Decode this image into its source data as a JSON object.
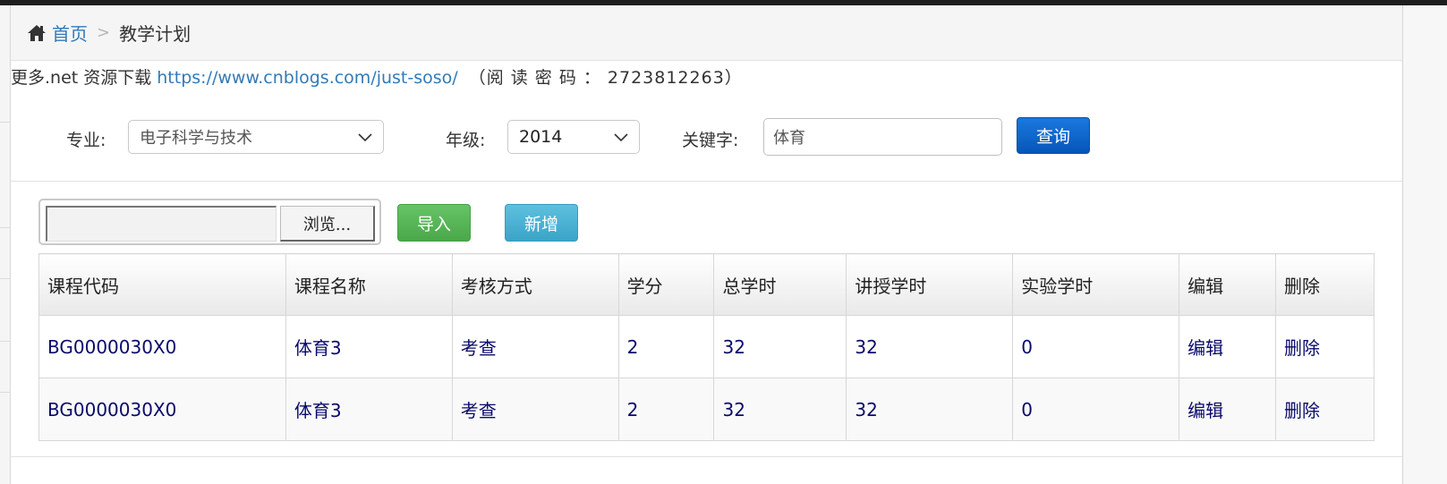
{
  "breadcrumb": {
    "icon": "home-icon",
    "home": "首页",
    "separator": ">",
    "current": "教学计划"
  },
  "notice": {
    "prefix": "更多.net 资源下载",
    "link": "https://www.cnblogs.com/just-soso/",
    "password": "（阅 读 密 码 ： 2723812263）"
  },
  "filters": {
    "major_label": "专业:",
    "major_value": "电子科学与技术",
    "grade_label": "年级:",
    "grade_value": "2014",
    "keyword_label": "关键字:",
    "keyword_value": "体育",
    "query_button": "查询"
  },
  "actions": {
    "browse_button": "浏览...",
    "import_button": "导入",
    "add_button": "新增"
  },
  "colors": {
    "link": "#337ab7",
    "query_button": "#0656b8",
    "import_button": "#4aa84a",
    "add_button": "#3aa4c8",
    "cell_text": "#0a0a6a"
  },
  "table": {
    "headers": [
      "课程代码",
      "课程名称",
      "考核方式",
      "学分",
      "总学时",
      "讲授学时",
      "实验学时",
      "编辑",
      "删除"
    ],
    "rows": [
      [
        "BG0000030X0",
        "体育3",
        "考查",
        "2",
        "32",
        "32",
        "0",
        "编辑",
        "删除"
      ],
      [
        "BG0000030X0",
        "体育3",
        "考查",
        "2",
        "32",
        "32",
        "0",
        "编辑",
        "删除"
      ]
    ]
  }
}
